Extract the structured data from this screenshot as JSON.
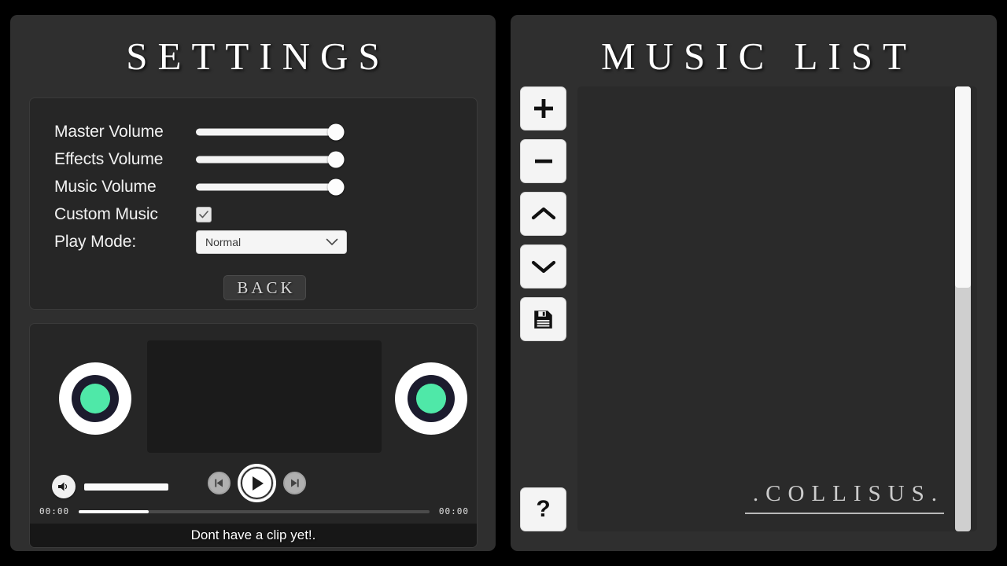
{
  "settings": {
    "title": "SETTINGS",
    "rows": [
      {
        "label": "Master Volume",
        "control": "slider",
        "value": 100
      },
      {
        "label": "Effects Volume",
        "control": "slider",
        "value": 100
      },
      {
        "label": "Music Volume",
        "control": "slider",
        "value": 100
      },
      {
        "label": "Custom Music",
        "control": "checkbox",
        "checked": true
      },
      {
        "label": "Play Mode:",
        "control": "select",
        "value": "Normal"
      }
    ],
    "back_label": "BACK"
  },
  "player": {
    "time_current": "00:00",
    "time_total": "00:00",
    "progress_percent": 20,
    "volume_percent": 100,
    "status_text": "Dont have a clip yet!.",
    "icons": {
      "volume": "speaker-icon",
      "previous": "previous-icon",
      "play": "play-icon",
      "next": "next-icon"
    },
    "cone_colors": {
      "outer": "#ffffff",
      "middle": "#1c1c2e",
      "inner": "#4fe8a8"
    }
  },
  "musiclist": {
    "title": "MUSIC LIST",
    "toolbar": [
      {
        "name": "add",
        "icon": "plus-icon"
      },
      {
        "name": "remove",
        "icon": "minus-icon"
      },
      {
        "name": "move-up",
        "icon": "chevron-up-icon"
      },
      {
        "name": "move-down",
        "icon": "chevron-down-icon"
      },
      {
        "name": "save",
        "icon": "floppy-disk-icon"
      }
    ],
    "help_label": "?",
    "items": [],
    "watermark": ".COLLISUS.",
    "scrollbar": {
      "thumb_percent": 45
    }
  },
  "theme": {
    "panel_bg": "#2f2f2f",
    "card_bg": "#262626",
    "accent": "#4fe8a8",
    "page_bg": "#000000"
  }
}
